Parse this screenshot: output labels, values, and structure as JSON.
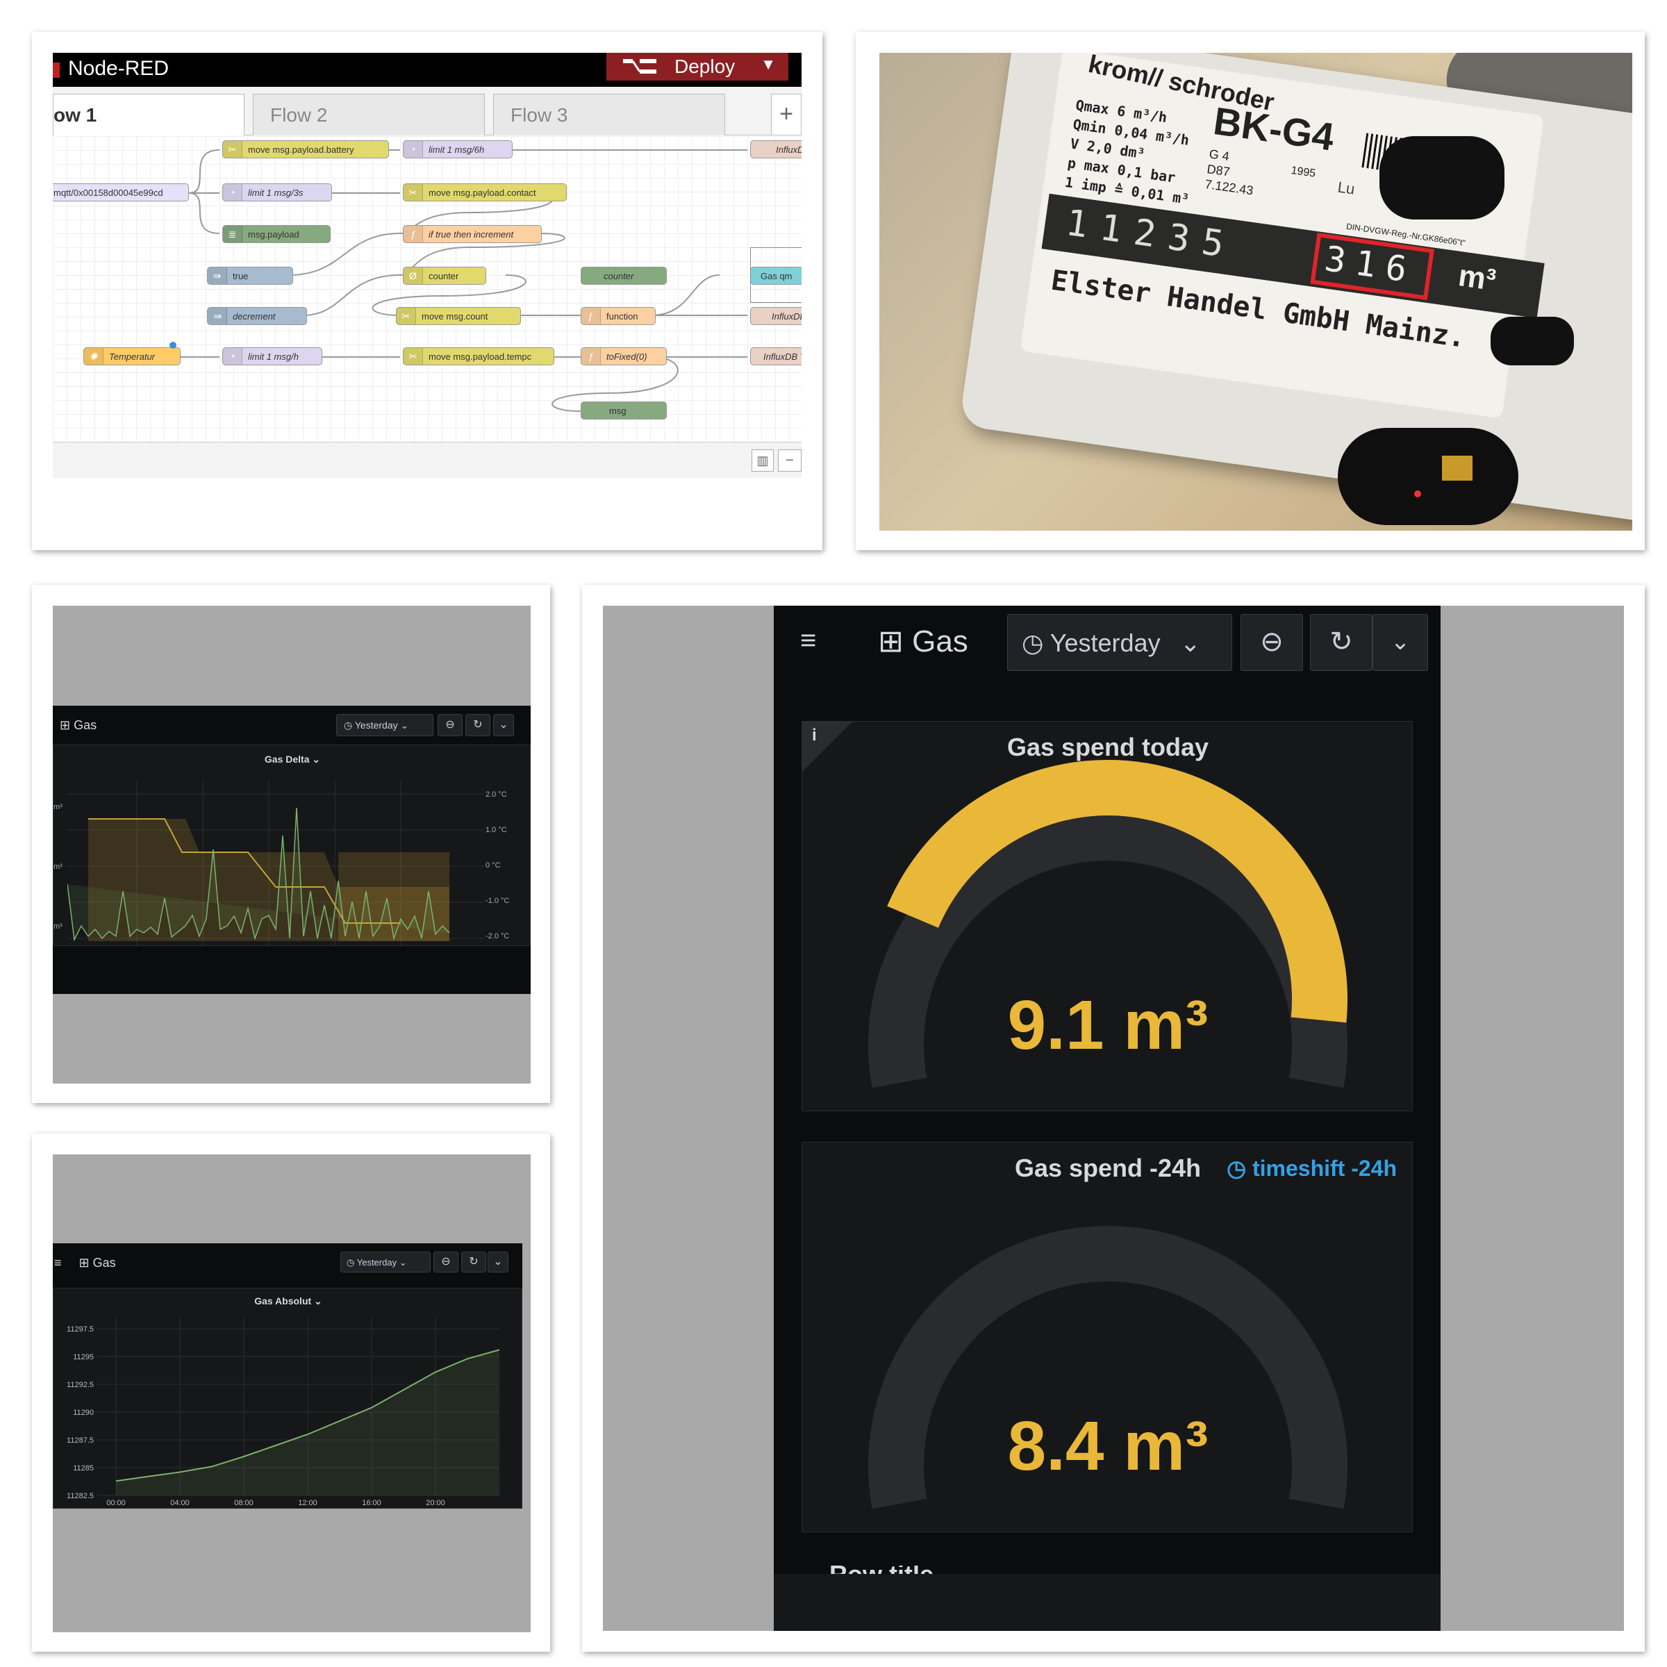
{
  "nodered": {
    "title": "Node-RED",
    "deploy_label": "Deploy",
    "tabs": [
      "ow 1",
      "Flow 2",
      "Flow 3"
    ],
    "nodes": {
      "battery": "move msg.payload.battery",
      "limit6h": "limit 1 msg/6h",
      "influx1": "InfluxDB",
      "mqtt": "mqtt/0x00158d00045e99cd",
      "limit3s": "limit 1 msg/3s",
      "contact": "move msg.payload.contact",
      "payload": "msg.payload",
      "iftrue": "if true then increment",
      "true": "true",
      "counter": "counter",
      "counter2": "counter",
      "gasqm": "Gas qm",
      "decrement": "decrement",
      "movecount": "move msg.count",
      "function": "function",
      "influx2": "InfluxDB",
      "temperatur": "Temperatur",
      "limith": "limit 1 msg/h",
      "tempc": "move msg.payload.tempc",
      "tofixed": "toFixed(0)",
      "influx3": "InfluxDB Te",
      "msg": "msg"
    }
  },
  "meter": {
    "brand": "krom// schroder",
    "model": "BK-G4",
    "specs": [
      "Qmax 6 m³/h",
      "Qmin 0,04 m³/h",
      "V 2,0 dm³",
      "p max 0,1 bar",
      "1 imp ≙ 0,01 m³"
    ],
    "class": "G 4",
    "year": "1995",
    "code1": "D87",
    "code2": "7.122.43",
    "reg": "DIN-DVGW-Reg.-Nr.GK86e06\"t\"",
    "digits": [
      "1",
      "1",
      "2",
      "3",
      "5"
    ],
    "decimals": [
      "3",
      "1",
      "6"
    ],
    "unit": "m³",
    "maker": "Elster Handel GmbH Mainz.",
    "lu": "Lu"
  },
  "gas_delta": {
    "dashboard": "Gas",
    "time_range": "Yesterday",
    "panel_title": "Gas Delta",
    "left_ticks": [
      "m³",
      "m³",
      "m³"
    ],
    "right_ticks": [
      "2.0 °C",
      "1.0 °C",
      "0 °C",
      "-1.0 °C",
      "-2.0 °C"
    ]
  },
  "gas_absolut": {
    "dashboard": "Gas",
    "time_range": "Yesterday",
    "panel_title": "Gas Absolut",
    "chart_data": {
      "type": "line",
      "title": "Gas Absolut",
      "x": [
        "00:00",
        "04:00",
        "08:00",
        "12:00",
        "16:00",
        "20:00"
      ],
      "y_ticks": [
        "11297.5",
        "11295",
        "11292.5",
        "11290",
        "11287.5",
        "11285",
        "11282.5"
      ],
      "ylim": [
        11282.5,
        11298.5
      ],
      "series": [
        {
          "x": [
            0,
            2,
            4,
            6,
            8,
            10,
            12,
            14,
            16,
            18,
            20,
            22,
            24
          ],
          "values": [
            11283.8,
            11284.2,
            11284.6,
            11285.1,
            11286.0,
            11287.0,
            11288.0,
            11289.2,
            11290.4,
            11292.0,
            11293.6,
            11294.8,
            11295.6
          ]
        }
      ]
    }
  },
  "gauges": {
    "dashboard": "Gas",
    "time_range": "Yesterday",
    "today": {
      "title": "Gas spend today",
      "value": "9.1 m³",
      "fraction": 0.72,
      "color": "#eab839"
    },
    "minus24": {
      "title": "Gas spend -24h",
      "timeshift": "timeshift -24h",
      "value": "8.4 m³",
      "fraction": 0.0,
      "color": "#eab839"
    },
    "next_title": "Row title"
  }
}
